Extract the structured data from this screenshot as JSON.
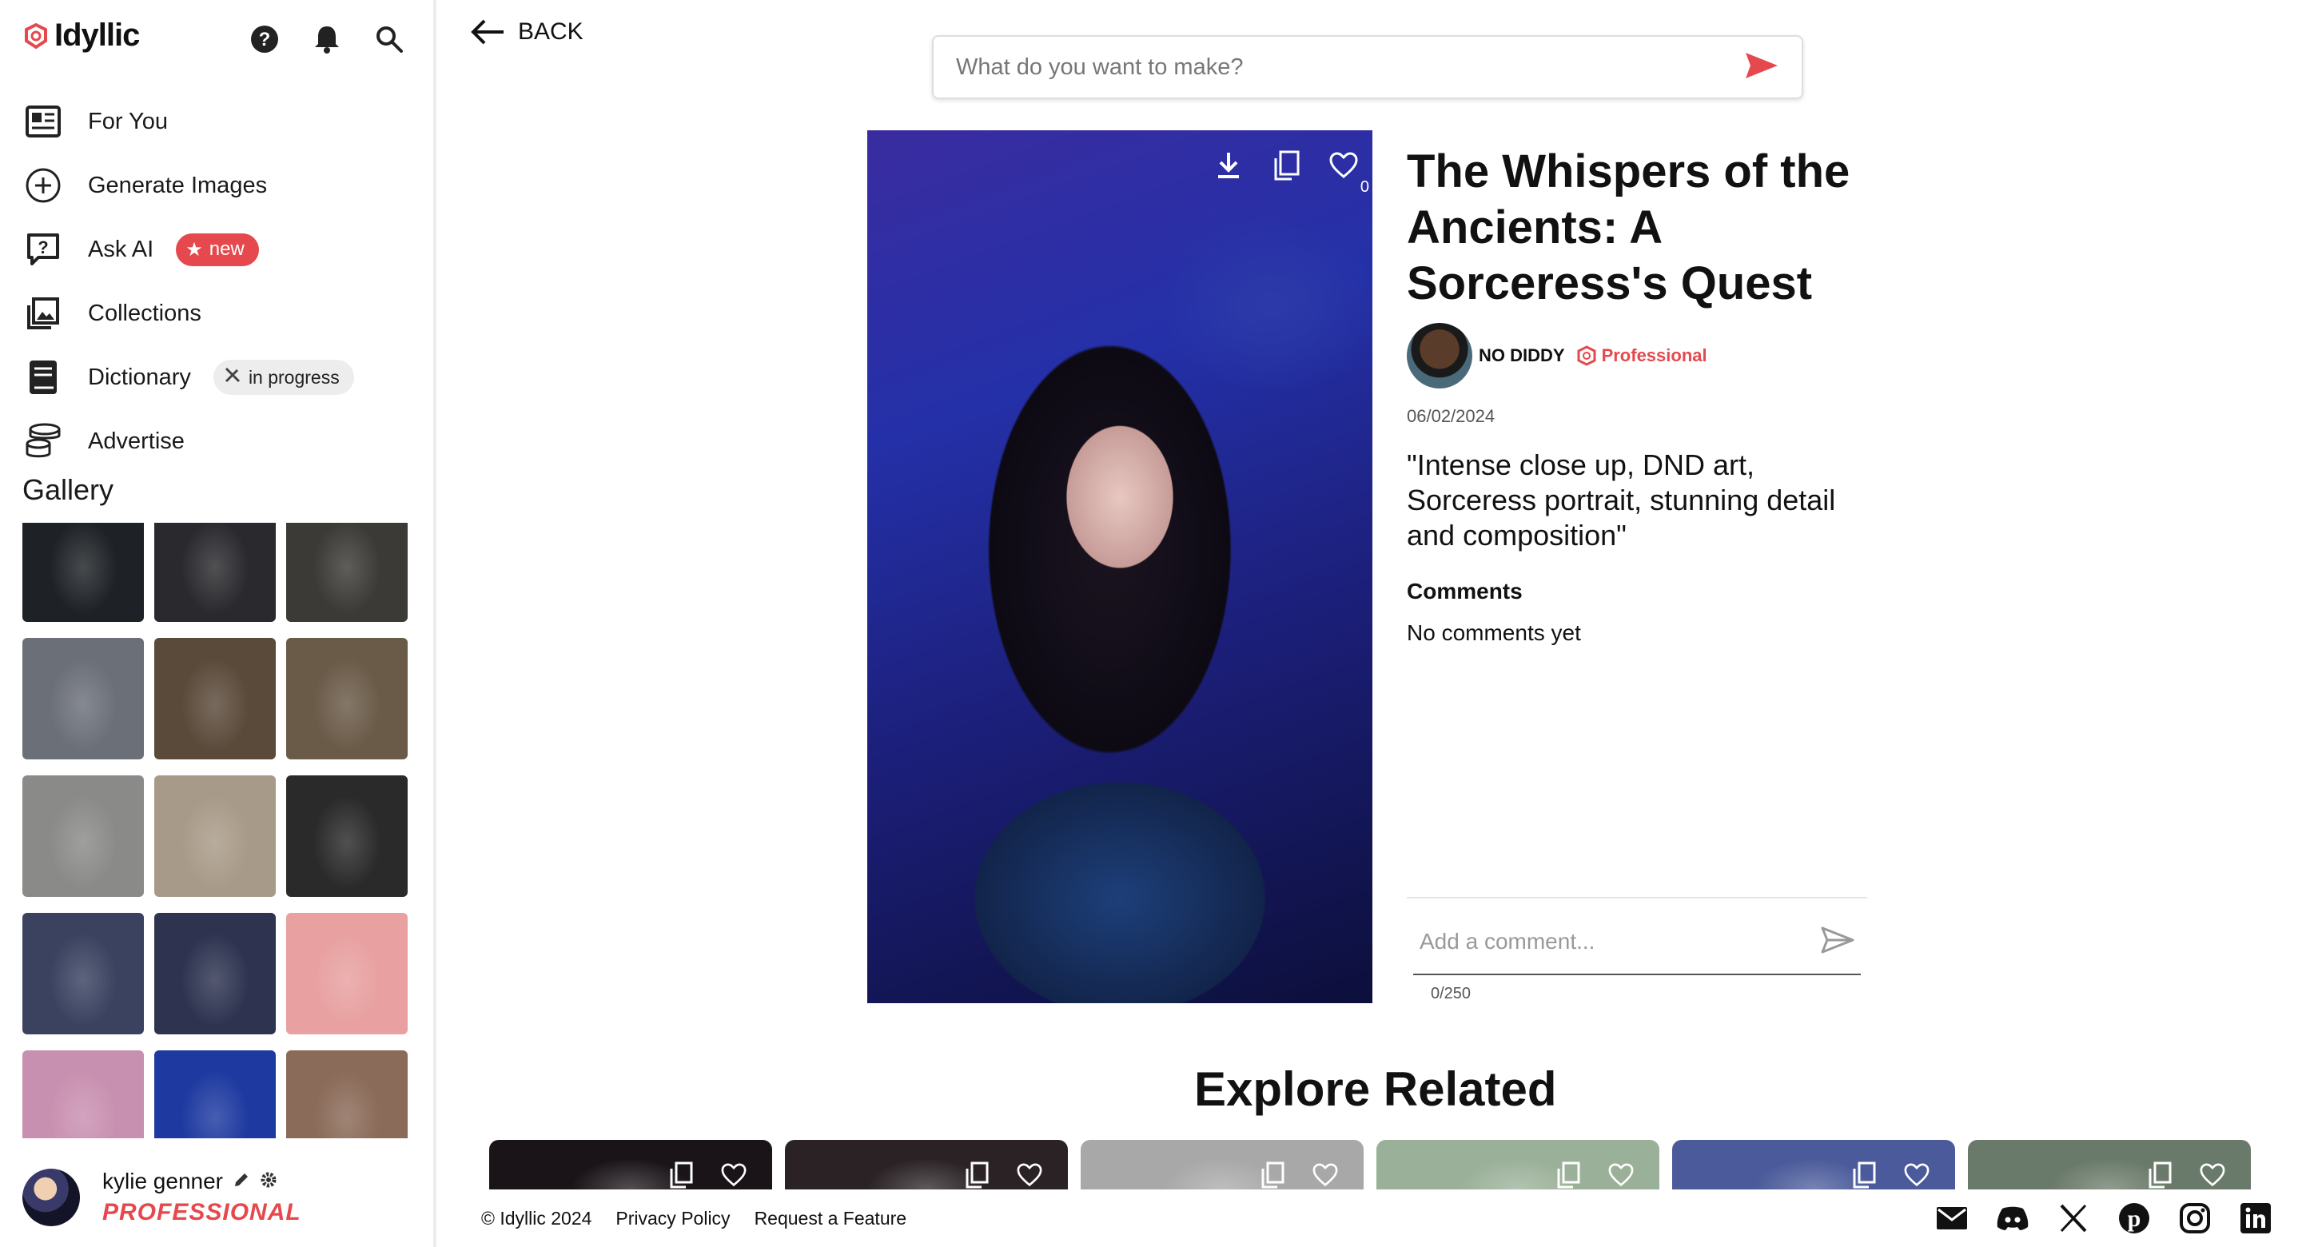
{
  "app": {
    "name": "Idyllic"
  },
  "sidebar": {
    "items": [
      {
        "label": "For You",
        "icon": "newspaper-icon"
      },
      {
        "label": "Generate Images",
        "icon": "plus-circle-icon"
      },
      {
        "label": "Ask AI",
        "icon": "question-box-icon",
        "badge": "new"
      },
      {
        "label": "Collections",
        "icon": "image-stack-icon"
      },
      {
        "label": "Dictionary",
        "icon": "book-icon",
        "badge": "in progress"
      },
      {
        "label": "Advertise",
        "icon": "coins-icon"
      }
    ],
    "gallery_title": "Gallery",
    "gallery_colors": [
      [
        "#1e2226",
        "#2a2a2e",
        "#3c3a36"
      ],
      [
        "#6b6f78",
        "#5a4a3a",
        "#6a5a48"
      ],
      [
        "#8a8a88",
        "#a89a88",
        "#2a2a2a"
      ],
      [
        "#3a4260",
        "#2e3450",
        "#e8a0a0"
      ],
      [
        "#c890b0",
        "#1e3aa0",
        "#8a6a58"
      ],
      [
        "#a89878",
        "#e0a040",
        "#3a8ab0"
      ]
    ]
  },
  "user": {
    "name": "kylie genner",
    "tier": "PROFESSIONAL"
  },
  "header": {
    "back_label": "BACK",
    "prompt_placeholder": "What do you want to make?"
  },
  "image": {
    "like_count": "0"
  },
  "detail": {
    "title": "The Whispers of the Ancients: A Sorceress's Quest",
    "author": "NO DIDDY",
    "author_badge": "Professional",
    "date": "06/02/2024",
    "prompt": "\"Intense close up, DND art, Sorceress portrait, stunning detail and composition\"",
    "comments_heading": "Comments",
    "no_comments": "No comments yet",
    "comment_placeholder": "Add a comment...",
    "comment_counter": "0/250"
  },
  "explore": {
    "title": "Explore Related",
    "colors": [
      "#1a1418",
      "#2a2224",
      "#a8a8a8",
      "#9ab098",
      "#4a5a9a",
      "#6a7a6a"
    ]
  },
  "footer": {
    "copyright": "© Idyllic 2024",
    "privacy": "Privacy Policy",
    "request": "Request a Feature",
    "social": [
      "mail-icon",
      "discord-icon",
      "x-icon",
      "pinterest-icon",
      "instagram-icon",
      "linkedin-icon"
    ]
  },
  "colors": {
    "accent": "#e5484d",
    "border": "#ececec"
  }
}
